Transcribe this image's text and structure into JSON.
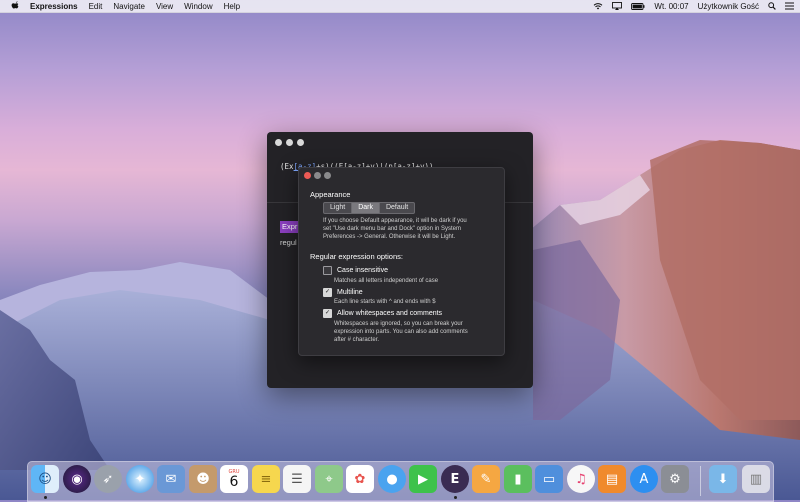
{
  "menubar": {
    "app_name": "Expressions",
    "items": [
      "Edit",
      "Navigate",
      "View",
      "Window",
      "Help"
    ],
    "clock": "Wt. 00:07",
    "user": "Użytkownik Gość"
  },
  "main_window": {
    "regex_prefix": "(Ex",
    "regex_class": "[a-z]",
    "regex_rest": "+s)((E[a-z]+y)|(n[a-z]+y))",
    "sample_highlight": "Expr",
    "sample_text": "regul"
  },
  "preferences": {
    "appearance_heading": "Appearance",
    "appearance_options": [
      "Light",
      "Dark",
      "Default"
    ],
    "appearance_selected": "Dark",
    "appearance_desc": [
      "If you choose Default appearance, it will be dark if you",
      "set \"Use dark menu bar and Dock\" option in System",
      "Preferences -> General. Otherwise it will be Light."
    ],
    "options_heading": "Regular expression options:",
    "options": [
      {
        "label": "Case insensitive",
        "checked": false,
        "desc": [
          "Matches all letters independent of case"
        ]
      },
      {
        "label": "Multiline",
        "checked": true,
        "desc": [
          "Each line starts with ^ and ends with $"
        ]
      },
      {
        "label": "Allow whitespaces and comments",
        "checked": true,
        "desc": [
          "Whitespaces are ignored, so you can break your",
          "expression into parts. You can also add comments",
          "after # character."
        ]
      }
    ]
  },
  "dock": {
    "calendar_month": "GRU",
    "calendar_day": "6",
    "expressions_letter": "E",
    "icons": [
      "finder-icon",
      "siri-icon",
      "launchpad-icon",
      "safari-icon",
      "mail-icon",
      "contacts-icon",
      "calendar-icon",
      "notes-icon",
      "reminders-icon",
      "maps-icon",
      "photos-icon",
      "messages-icon",
      "facetime-icon",
      "expressions-icon",
      "pages-icon",
      "numbers-icon",
      "keynote-icon",
      "itunes-icon",
      "ibooks-icon",
      "app-store-icon",
      "system-preferences-icon",
      "downloads-icon",
      "trash-icon"
    ]
  },
  "colors": {
    "accent_purple": "#8b3fc0",
    "close_red": "#ec5a55"
  }
}
